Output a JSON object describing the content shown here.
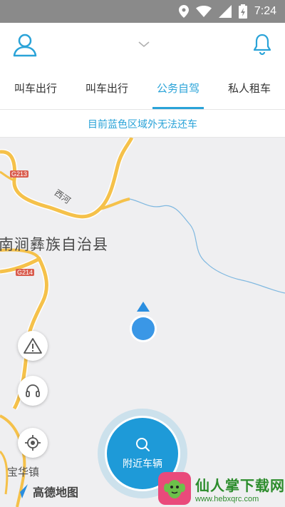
{
  "status_bar": {
    "time": "7:24"
  },
  "tabs": [
    {
      "label": "叫车出行",
      "active": false
    },
    {
      "label": "叫车出行",
      "active": false
    },
    {
      "label": "公务自驾",
      "active": true
    },
    {
      "label": "私人租车",
      "active": false
    }
  ],
  "notice": "目前蓝色区域外无法还车",
  "map": {
    "road_labels": [
      "G213",
      "G214"
    ],
    "place_county": "南涧彝族自治县",
    "place_river": "西河",
    "place_town": "宝华镇",
    "amap_logo_text": "高德地图"
  },
  "nearby_button": {
    "label": "附近车辆"
  },
  "watermark": {
    "main": "仙人掌下载网",
    "url": "www.hebxqrc.com"
  },
  "colors": {
    "accent": "#2aa3d8",
    "road": "#f5c14a",
    "river": "#7fb8e0"
  }
}
